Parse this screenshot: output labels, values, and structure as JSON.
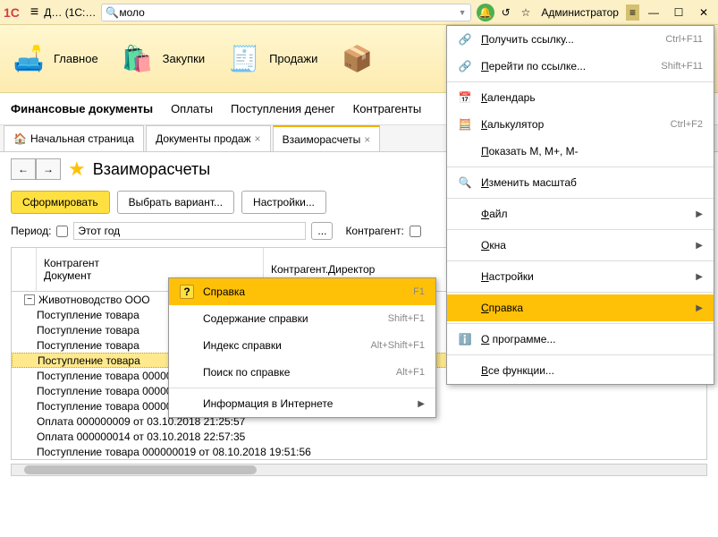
{
  "titlebar": {
    "logo": "1C",
    "title": "Д…  (1С:…",
    "search_value": "моло",
    "user": "Администратор"
  },
  "nav": {
    "items": [
      {
        "label": "Главное",
        "icon": "🛋️"
      },
      {
        "label": "Закупки",
        "icon": "🛍️"
      },
      {
        "label": "Продажи",
        "icon": "🧾"
      }
    ]
  },
  "subnav": {
    "items": [
      "Финансовые документы",
      "Оплаты",
      "Поступления денег",
      "Контрагенты"
    ]
  },
  "tabs": [
    {
      "label": "Начальная страница",
      "icon": "🏠",
      "closable": false
    },
    {
      "label": "Документы продаж",
      "closable": true
    },
    {
      "label": "Взаиморасчеты",
      "closable": true,
      "active": true
    }
  ],
  "page": {
    "title": "Взаиморасчеты",
    "btn_form": "Сформировать",
    "btn_variant": "Выбрать вариант...",
    "btn_settings": "Настройки..."
  },
  "filter": {
    "period_label": "Период:",
    "period_value": "Этот год",
    "period_dots": "...",
    "counterparty_label": "Контрагент:"
  },
  "grid": {
    "header1": "Контрагент",
    "header1b": "Документ",
    "header2": "Контрагент.Директор",
    "group": "Животноводство ООО",
    "rows": [
      "Поступление товара",
      "Поступление товара",
      "Поступление товара",
      "Поступление товара",
      "Поступление товара 000000041 от 11.09.2018 22:55:29",
      "Поступление товара 000000007 от 15.09.2018 11:37:45",
      "Поступление товара 000000016 от 20.09.2018 15:20:32",
      "Оплата 000000009 от 03.10.2018 21:25:57",
      "Оплата 000000014 от 03.10.2018 22:57:35",
      "Поступление товара 000000019 от 08.10.2018 19:51:56"
    ]
  },
  "main_menu": [
    {
      "icon": "🔗",
      "label": "Получить ссылку...",
      "shortcut": "Ctrl+F11"
    },
    {
      "icon": "🔗",
      "label": "Перейти по ссылке...",
      "shortcut": "Shift+F11"
    },
    {
      "sep": true
    },
    {
      "icon": "📅",
      "label": "Календарь"
    },
    {
      "icon": "🧮",
      "label": "Калькулятор",
      "shortcut": "Ctrl+F2"
    },
    {
      "label": "Показать M, M+, M-"
    },
    {
      "sep": true
    },
    {
      "icon": "🔍",
      "label": "Изменить масштаб"
    },
    {
      "sep": true
    },
    {
      "label": "Файл",
      "arrow": true
    },
    {
      "sep": true
    },
    {
      "label": "Окна",
      "arrow": true
    },
    {
      "sep": true
    },
    {
      "label": "Настройки",
      "arrow": true
    },
    {
      "sep": true
    },
    {
      "label": "Справка",
      "arrow": true,
      "highlight": true
    },
    {
      "sep": true
    },
    {
      "icon": "ℹ️",
      "label": "О программе..."
    },
    {
      "sep": true
    },
    {
      "label": "Все функции..."
    }
  ],
  "sub_menu": [
    {
      "icon": "?",
      "label": "Справка",
      "shortcut": "F1",
      "highlight": true
    },
    {
      "label": "Содержание справки",
      "shortcut": "Shift+F1"
    },
    {
      "label": "Индекс справки",
      "shortcut": "Alt+Shift+F1"
    },
    {
      "label": "Поиск по справке",
      "shortcut": "Alt+F1"
    },
    {
      "sep": true
    },
    {
      "label": "Информация в Интернете",
      "arrow": true
    }
  ]
}
